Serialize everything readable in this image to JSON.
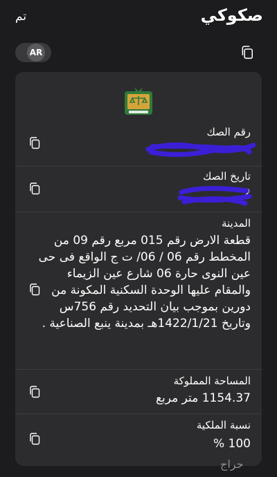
{
  "header": {
    "title": "صكوكي",
    "done_label": "تم"
  },
  "language_toggle": {
    "label": "AR"
  },
  "document": {
    "fields": [
      {
        "label": "رقم الصك",
        "value": ""
      },
      {
        "label": "تاريخ الصك",
        "value": "2"
      },
      {
        "label": "المدينة",
        "value": "قطعة الارض رقم 015 مربع رقم 09 من المخطط رقم 06 / 06/ ت ج الواقع فى حى عين النوى حارة 06 شارع عين الزيماء والمقام عليها الوحدة السكنية المكونة من دورين بموجب بيان التحديد رقم 756س وتاريخ 1422/1/21هـ بمدينة ينبع الصناعية ."
      },
      {
        "label": "المساحة المملوكة",
        "value": "1154.37 متر مربع"
      },
      {
        "label": "نسبة الملكية",
        "value": "100 %"
      }
    ]
  },
  "watermark": "حراج",
  "colors": {
    "background": "#1c1c1e",
    "card": "#2c2c2e",
    "redaction": "#3b1fd6",
    "emblem_green": "#2f7a3a",
    "emblem_gold": "#d4a43a"
  }
}
